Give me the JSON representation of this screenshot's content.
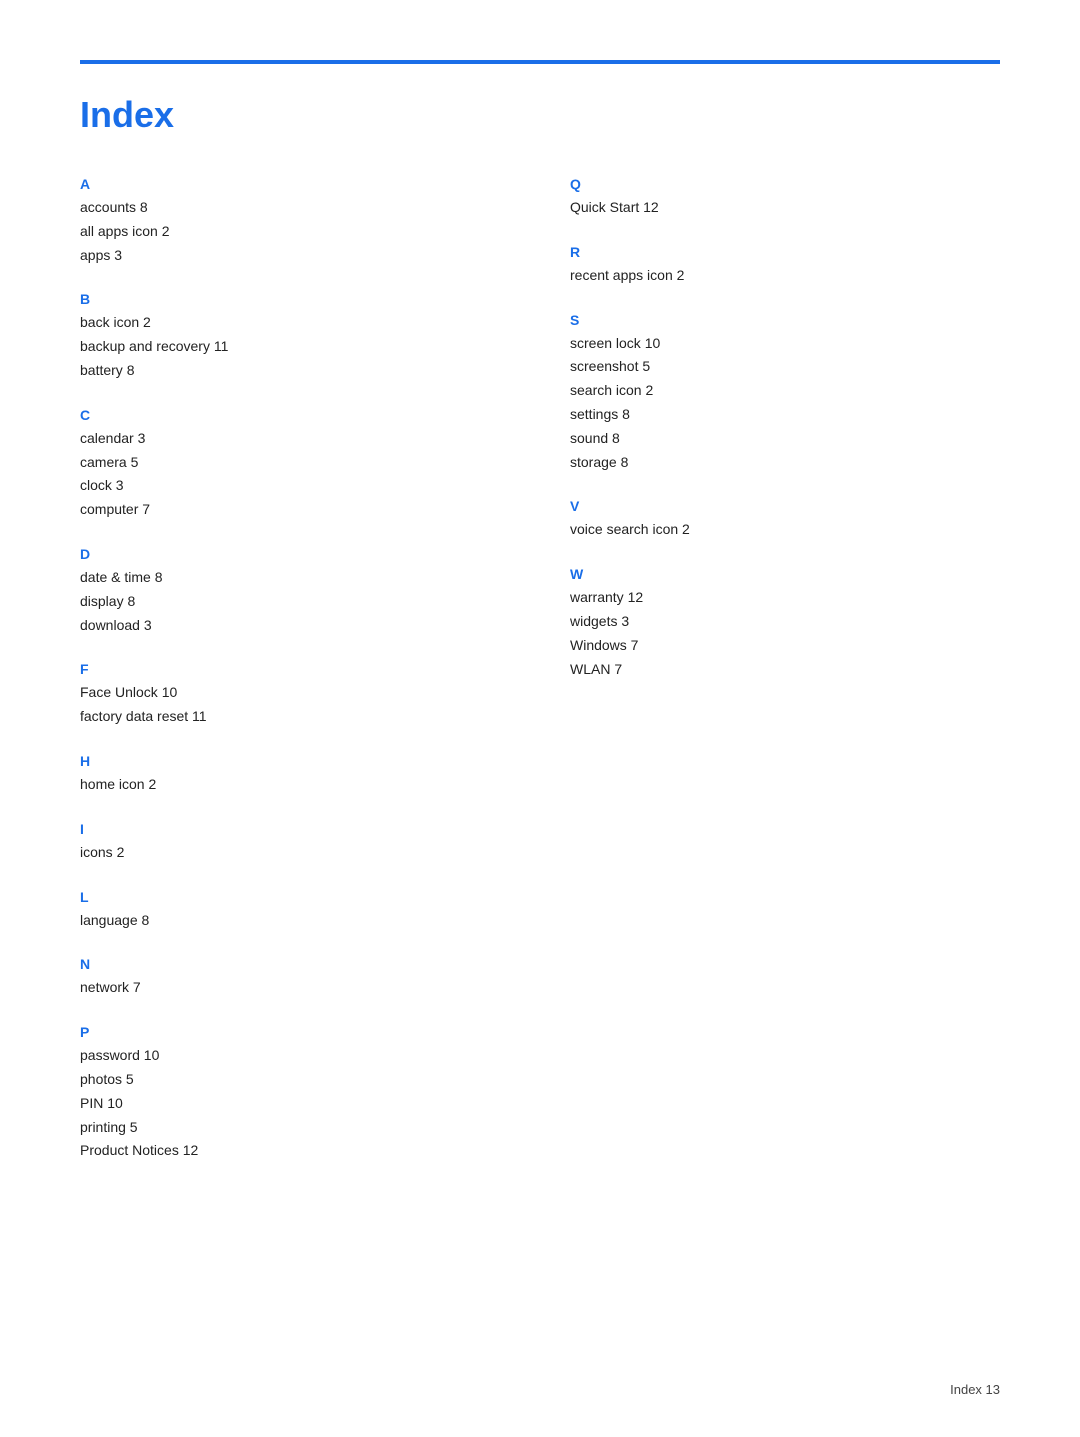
{
  "page": {
    "title": "Index",
    "footer": "Index   13"
  },
  "left_column": [
    {
      "letter": "A",
      "entries": [
        {
          "term": "accounts",
          "page": "8"
        },
        {
          "term": "all apps icon",
          "page": "2"
        },
        {
          "term": "apps",
          "page": "3"
        }
      ]
    },
    {
      "letter": "B",
      "entries": [
        {
          "term": "back icon",
          "page": "2"
        },
        {
          "term": "backup and recovery",
          "page": "11"
        },
        {
          "term": "battery",
          "page": "8"
        }
      ]
    },
    {
      "letter": "C",
      "entries": [
        {
          "term": "calendar",
          "page": "3"
        },
        {
          "term": "camera",
          "page": "5"
        },
        {
          "term": "clock",
          "page": "3"
        },
        {
          "term": "computer",
          "page": "7"
        }
      ]
    },
    {
      "letter": "D",
      "entries": [
        {
          "term": "date & time",
          "page": "8"
        },
        {
          "term": "display",
          "page": "8"
        },
        {
          "term": "download",
          "page": "3"
        }
      ]
    },
    {
      "letter": "F",
      "entries": [
        {
          "term": "Face Unlock",
          "page": "10"
        },
        {
          "term": "factory data reset",
          "page": "11"
        }
      ]
    },
    {
      "letter": "H",
      "entries": [
        {
          "term": "home icon",
          "page": "2"
        }
      ]
    },
    {
      "letter": "I",
      "entries": [
        {
          "term": "icons",
          "page": "2"
        }
      ]
    },
    {
      "letter": "L",
      "entries": [
        {
          "term": "language",
          "page": "8"
        }
      ]
    },
    {
      "letter": "N",
      "entries": [
        {
          "term": "network",
          "page": "7"
        }
      ]
    },
    {
      "letter": "P",
      "entries": [
        {
          "term": "password",
          "page": "10"
        },
        {
          "term": "photos",
          "page": "5"
        },
        {
          "term": "PIN",
          "page": "10"
        },
        {
          "term": "printing",
          "page": "5"
        },
        {
          "term": "Product Notices",
          "page": "12"
        }
      ]
    }
  ],
  "right_column": [
    {
      "letter": "Q",
      "entries": [
        {
          "term": "Quick Start",
          "page": "12"
        }
      ]
    },
    {
      "letter": "R",
      "entries": [
        {
          "term": "recent apps icon",
          "page": "2"
        }
      ]
    },
    {
      "letter": "S",
      "entries": [
        {
          "term": "screen lock",
          "page": "10"
        },
        {
          "term": "screenshot",
          "page": "5"
        },
        {
          "term": "search icon",
          "page": "2"
        },
        {
          "term": "settings",
          "page": "8"
        },
        {
          "term": "sound",
          "page": "8"
        },
        {
          "term": "storage",
          "page": "8"
        }
      ]
    },
    {
      "letter": "V",
      "entries": [
        {
          "term": "voice search icon",
          "page": "2"
        }
      ]
    },
    {
      "letter": "W",
      "entries": [
        {
          "term": "warranty",
          "page": "12"
        },
        {
          "term": "widgets",
          "page": "3"
        },
        {
          "term": "Windows",
          "page": "7"
        },
        {
          "term": "WLAN",
          "page": "7"
        }
      ]
    }
  ]
}
